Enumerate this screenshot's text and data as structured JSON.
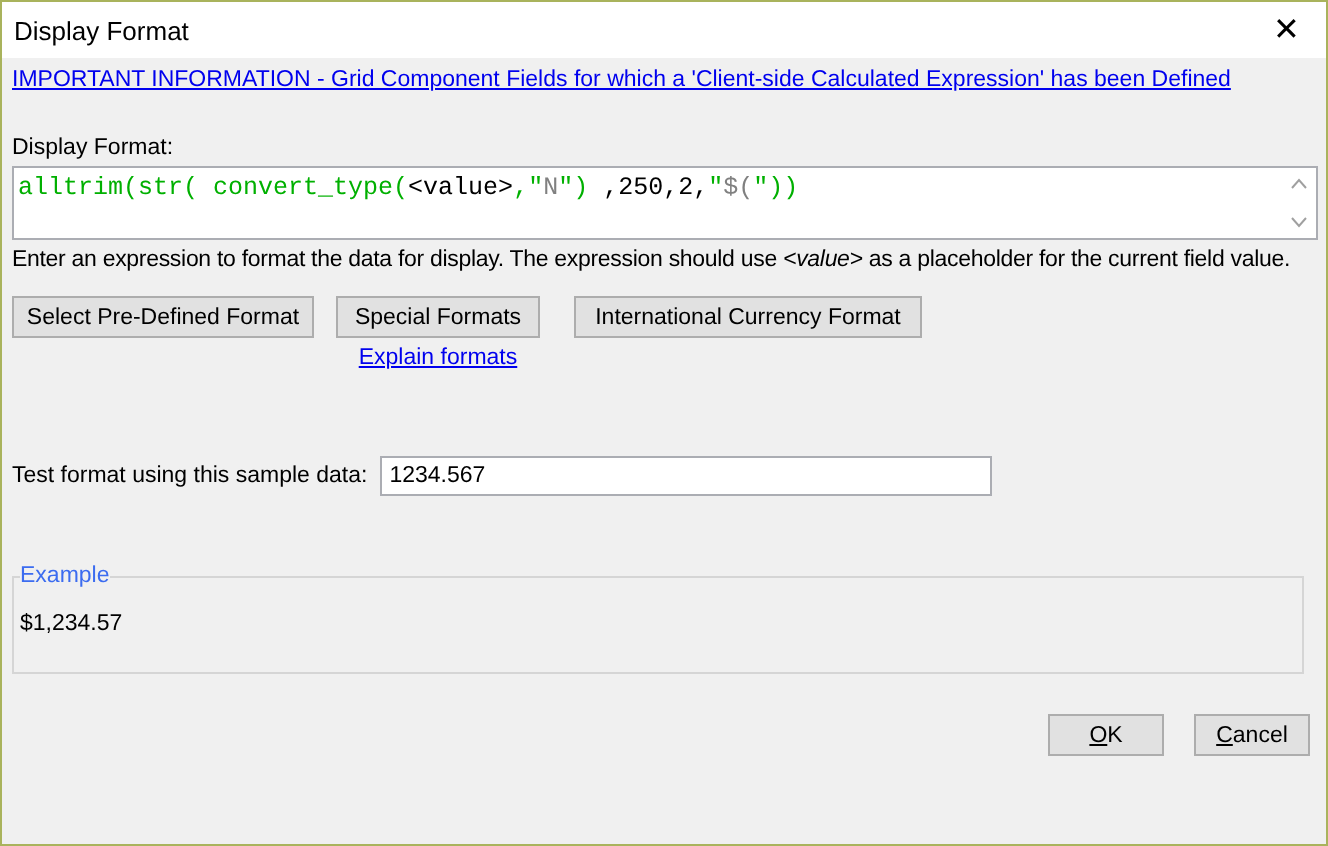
{
  "window": {
    "title": "Display Format",
    "close": "✕"
  },
  "info_link": "IMPORTANT INFORMATION - Grid Component Fields for which a 'Client-side Calculated Expression' has been Defined",
  "display_format": {
    "label": "Display Format:",
    "tokens": [
      {
        "kind": "code",
        "text": "alltrim(str( convert_type("
      },
      {
        "kind": "plain",
        "text": "<value>"
      },
      {
        "kind": "code",
        "text": ",\""
      },
      {
        "kind": "string",
        "text": "N"
      },
      {
        "kind": "code",
        "text": "\") "
      },
      {
        "kind": "plain",
        "text": ",250,2,"
      },
      {
        "kind": "code",
        "text": "\""
      },
      {
        "kind": "string",
        "text": "$("
      },
      {
        "kind": "code",
        "text": "\"))"
      }
    ]
  },
  "hint": "Enter an expression to format the data for display. The expression should use  *<value>*   as a placeholder for the current field value.",
  "format_buttons": [
    "Select Pre-Defined Format",
    "Special Formats",
    "International Currency Format"
  ],
  "explain_link": "Explain formats",
  "sample": {
    "label": "Test format using this sample data:",
    "value": "1234.567"
  },
  "example": {
    "legend": "Example",
    "value": "$1,234.57"
  },
  "buttons": [
    {
      "accel": "O",
      "rest": "K"
    },
    {
      "accel": "C",
      "rest": "ancel"
    }
  ]
}
